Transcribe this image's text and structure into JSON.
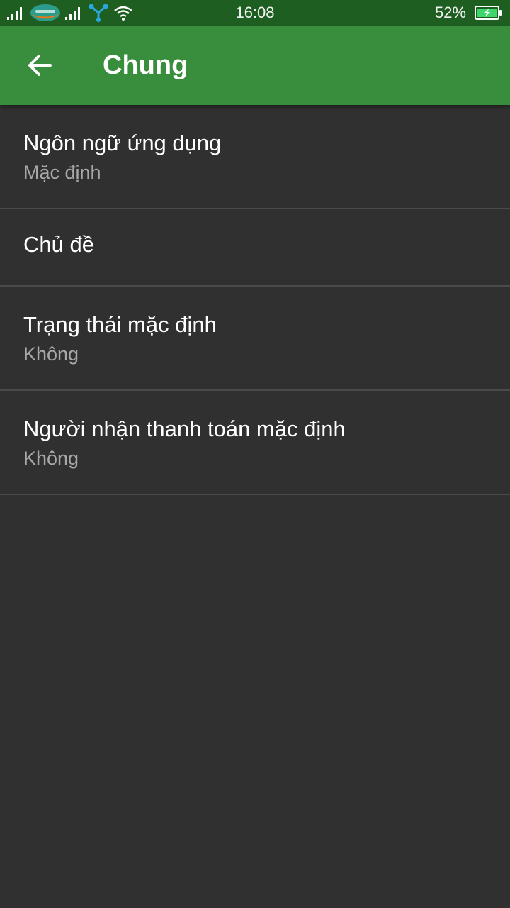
{
  "status_bar": {
    "time": "16:08",
    "battery_percent": "52%",
    "icons": [
      "signal-icon",
      "carrier-logo-icon",
      "signal-icon",
      "share-icon",
      "wifi-icon",
      "battery-charging-icon"
    ],
    "colors": {
      "background": "#1e5e20"
    }
  },
  "app_bar": {
    "title": "Chung",
    "back_icon": "arrow-left-icon",
    "colors": {
      "background": "#388e3c"
    }
  },
  "settings": [
    {
      "title": "Ngôn ngữ ứng dụng",
      "subtitle": "Mặc định"
    },
    {
      "title": "Chủ đề"
    },
    {
      "title": "Trạng thái mặc định",
      "subtitle": "Không"
    },
    {
      "title": "Người nhận thanh toán mặc định",
      "subtitle": "Không"
    }
  ],
  "colors": {
    "page_background": "#303030",
    "divider": "#4a4a4a",
    "primary_text": "#ffffff",
    "secondary_text": "#a8a8a8"
  }
}
